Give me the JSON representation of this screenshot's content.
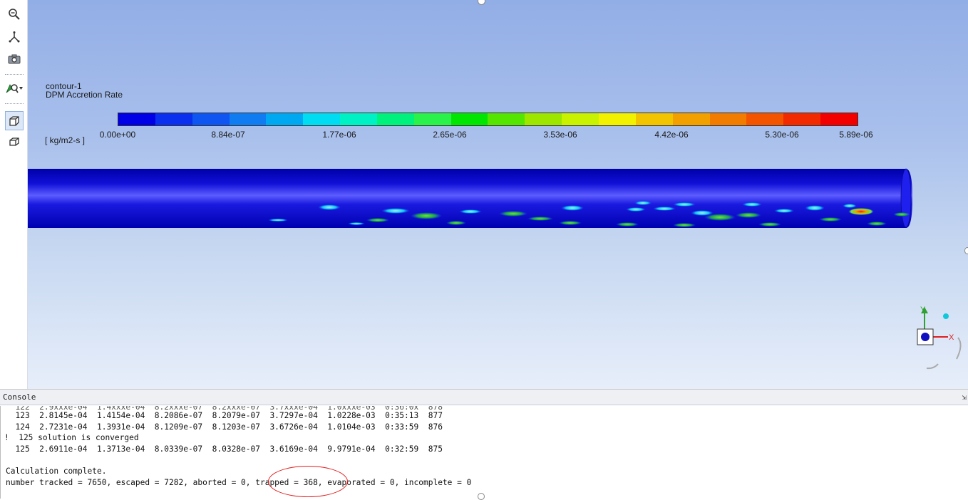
{
  "toolbar": {
    "items": [
      {
        "name": "zoom-icon",
        "label": "Zoom"
      },
      {
        "name": "fit-axes-icon",
        "label": "Axes"
      },
      {
        "name": "camera-icon",
        "label": "Save picture"
      },
      {
        "name": "probe-icon",
        "label": "Probe"
      },
      {
        "name": "view-box-icon",
        "label": "View"
      },
      {
        "name": "view-box-alt-icon",
        "label": "View"
      }
    ]
  },
  "legend": {
    "name": "contour-1",
    "variable": "DPM Accretion Rate",
    "unit": "[ kg/m2-s ]",
    "tick_labels": [
      "0.00e+00",
      "8.84e-07",
      "1.77e-06",
      "2.65e-06",
      "3.53e-06",
      "4.42e-06",
      "5.30e-06",
      "5.89e-06"
    ],
    "colors": [
      "#0000e6",
      "#0b2fef",
      "#0f55f1",
      "#0f7cf2",
      "#00a8f2",
      "#00dcf2",
      "#00f2c4",
      "#00f27c",
      "#2af24a",
      "#00e600",
      "#54e600",
      "#9ce600",
      "#c9f200",
      "#f2f200",
      "#f2c400",
      "#f2a000",
      "#f27c00",
      "#f25400",
      "#f22a00",
      "#f20000"
    ]
  },
  "triad": {
    "x_label": "X",
    "y_label": "Y"
  },
  "console": {
    "title": "Console",
    "lines": [
      "  123  2.8145e-04  1.4154e-04  8.2086e-07  8.2079e-07  3.7297e-04  1.0228e-03  0:35:13  877",
      "  124  2.7231e-04  1.3931e-04  8.1209e-07  8.1203e-07  3.6726e-04  1.0104e-03  0:33:59  876",
      "!  125 solution is converged",
      "  125  2.6911e-04  1.3713e-04  8.0339e-07  8.0328e-07  3.6169e-04  9.9791e-04  0:32:59  875",
      "",
      "Calculation complete.",
      "number tracked = 7650, escaped = 7282, aborted = 0, trapped = 368, evaporated = 0, incomplete = 0"
    ]
  }
}
